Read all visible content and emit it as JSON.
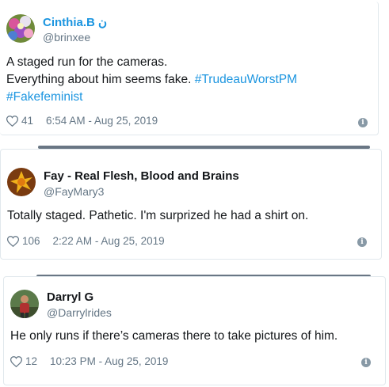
{
  "tweets": [
    {
      "name": "Cinthia.B ن",
      "handle": "@brinxee",
      "lines": [
        "A staged run for the cameras.",
        "Everything about him seems fake."
      ],
      "hashtags": [
        "#TrudeauWorstPM",
        "#Fakefeminist"
      ],
      "likes": "41",
      "time": "6:54 AM - Aug 25, 2019",
      "name_color": "#1b95e0"
    },
    {
      "name": "Fay - Real Flesh, Blood and Brains",
      "handle": "@FayMary3",
      "text": "Totally staged. Pathetic. I'm surprized he had a shirt on.",
      "likes": "106",
      "time": "2:22 AM - Aug 25, 2019",
      "name_color": "#14171a"
    },
    {
      "name": "Darryl G",
      "handle": "@Darrylrides",
      "text": "He only runs if there’s cameras there to take pictures of him.",
      "likes": "12",
      "time": "10:23 PM - Aug 25, 2019",
      "name_color": "#14171a"
    }
  ],
  "icons": {
    "like": "heart-outline-icon",
    "info": "info-icon"
  },
  "info_glyph": "i",
  "colors": {
    "link": "#1b95e0",
    "meta": "#657786",
    "border": "#e1e8ed"
  }
}
